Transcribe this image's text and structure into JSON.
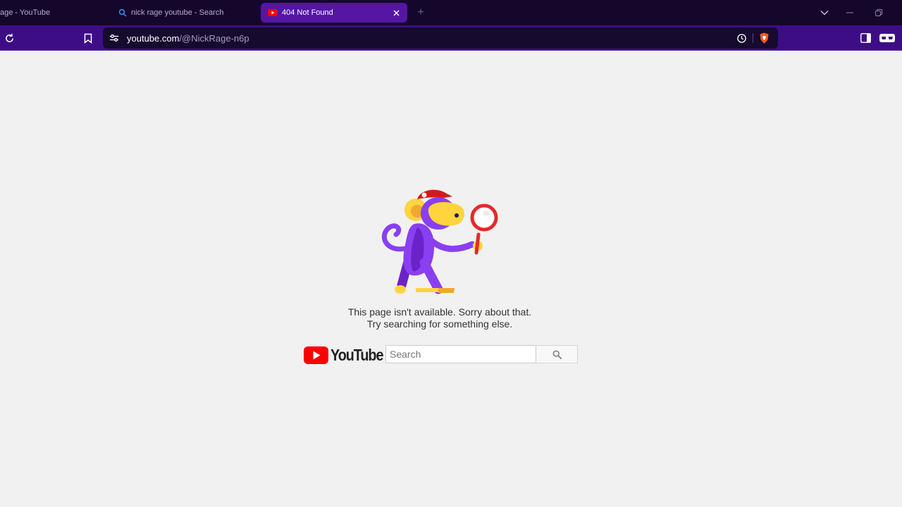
{
  "tabs": [
    {
      "label": "age - YouTube",
      "icon": "none"
    },
    {
      "label": "nick rage youtube - Search",
      "icon": "search-icon"
    },
    {
      "label": "404 Not Found",
      "icon": "youtube-favicon",
      "active": true
    }
  ],
  "address_bar": {
    "host": "youtube.com",
    "path": "/@NickRage-n6p"
  },
  "page": {
    "message_line1": "This page isn't available. Sorry about that.",
    "message_line2": "Try searching for something else.",
    "logo_text": "YouTube",
    "search_placeholder": "Search"
  },
  "colors": {
    "tab_strip": "#15072c",
    "active_tab": "#5516a6",
    "toolbar": "#3d0d86",
    "page_bg": "#f1f1f1",
    "youtube_red": "#ff0000"
  }
}
